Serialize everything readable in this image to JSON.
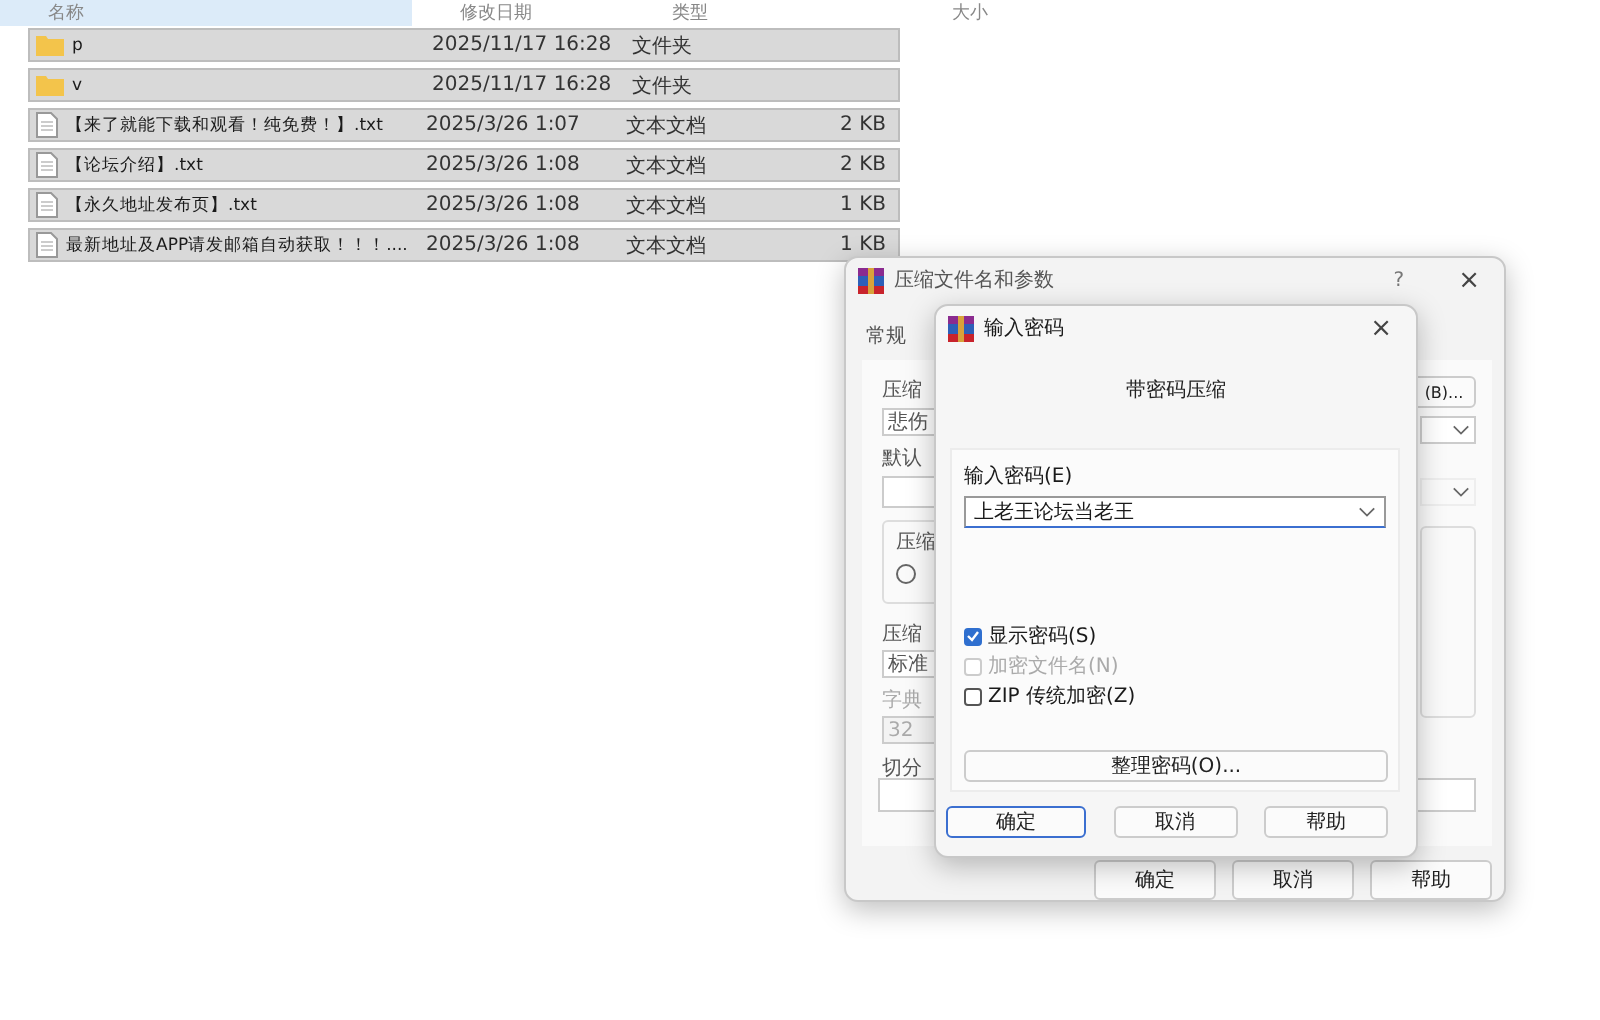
{
  "explorer": {
    "columns": [
      {
        "label": "名称",
        "selected": true
      },
      {
        "label": "修改日期",
        "selected": false
      },
      {
        "label": "类型",
        "selected": false
      },
      {
        "label": "大小",
        "selected": false
      }
    ],
    "files": [
      {
        "kind": "folder",
        "name": "p",
        "date": "2025/11/17 16:28",
        "type": "文件夹"
      },
      {
        "kind": "folder",
        "name": "v",
        "date": "2025/11/17 16:28",
        "type": "文件夹"
      },
      {
        "kind": "text",
        "name": "【来了就能下载和观看！纯免费！】.txt",
        "date": "2025/3/26 1:07",
        "type": "文本文档",
        "size": "2 KB"
      },
      {
        "kind": "text",
        "name": "【论坛介绍】.txt",
        "date": "2025/3/26 1:08",
        "type": "文本文档",
        "size": "2 KB"
      },
      {
        "kind": "text",
        "name": "【永久地址发布页】.txt",
        "date": "2025/3/26 1:08",
        "type": "文本文档",
        "size": "1 KB"
      },
      {
        "kind": "text",
        "name": "最新地址及APP请发邮箱自动获取！！！....",
        "date": "2025/3/26 1:08",
        "type": "文本文档",
        "size": "1 KB"
      }
    ]
  },
  "archive_dialog": {
    "title": "压缩文件名和参数",
    "help": "?",
    "close": "×",
    "tab": "常规",
    "archive_label": "压缩",
    "browse_button": "(B)...",
    "archive_name": "悲伤",
    "profile_label": "默认",
    "format_group": "压缩",
    "radio_checked": false,
    "method_label": "压缩",
    "method_value": "标准",
    "dict_label": "字典",
    "dict_value": "32",
    "split_label": "切分",
    "buttons": [
      "确定",
      "取消",
      "帮助"
    ]
  },
  "password_dialog": {
    "title": "输入密码",
    "close": "×",
    "heading": "带密码压缩",
    "password_label": "输入密码(E)",
    "password_value": "上老王论坛当老王",
    "options": [
      {
        "label": "显示密码(S)",
        "checked": true,
        "disabled": false
      },
      {
        "label": "加密文件名(N)",
        "checked": false,
        "disabled": true
      },
      {
        "label": "ZIP 传统加密(Z)",
        "checked": false,
        "disabled": false
      }
    ],
    "organize_button": "整理密码(O)...",
    "buttons": [
      {
        "label": "确定",
        "default": true
      },
      {
        "label": "取消",
        "default": false
      },
      {
        "label": "帮助",
        "default": false
      }
    ]
  }
}
